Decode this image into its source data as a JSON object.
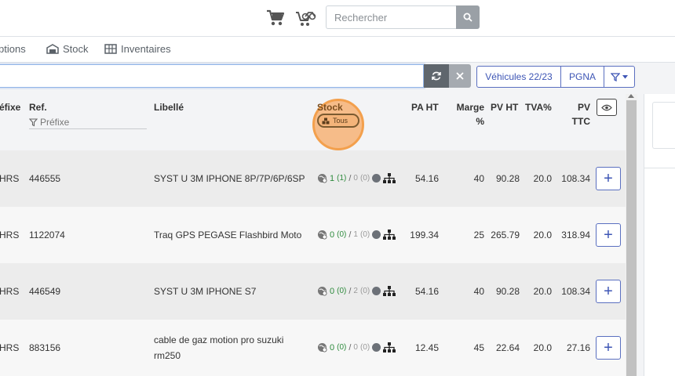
{
  "header": {
    "search_placeholder": "Rechercher",
    "icons": [
      "cart-icon",
      "motorbike-cart-icon",
      "search-icon"
    ]
  },
  "nav": {
    "items": [
      {
        "label": "ptions"
      },
      {
        "label": "Stock",
        "icon": "warehouse-icon"
      },
      {
        "label": "Inventaires",
        "icon": "inventory-icon"
      }
    ]
  },
  "filterbar": {
    "vehicles_label": "Véhicules 22/23",
    "pgna_label": "PGNA",
    "icons": [
      "refresh-icon",
      "close-icon",
      "filter-icon",
      "caret-down-icon"
    ]
  },
  "table": {
    "headers": {
      "prefix": "éfixe",
      "ref": "Ref.",
      "ref_filter_placeholder": "Préfixe",
      "libelle": "Libellé",
      "stock": "Stock",
      "stock_toggle": "Tous",
      "pa_ht": "PA HT",
      "marge_line1": "Marge",
      "marge_line2": "%",
      "pv_ht": "PV HT",
      "tva": "TVA%",
      "pv_ttc_line1": "PV",
      "pv_ttc_line2": "TTC"
    },
    "rows": [
      {
        "prefix": "HRS",
        "ref": "446555",
        "libelle_line1": "SYST U 3M IPHONE 8P/7P/6P/6SP",
        "libelle_line2": "",
        "stock_qty": "1",
        "stock_reserved": "(1)",
        "stock_order": "0",
        "stock_order_paren": "(0)",
        "pa_ht": "54.16",
        "marge": "40",
        "pv_ht": "90.28",
        "tva": "20.0",
        "pv_ttc": "108.34",
        "add_label": "+"
      },
      {
        "prefix": "HRS",
        "ref": "1122074",
        "libelle_line1": "Traq GPS PEGASE Flashbird Moto",
        "libelle_line2": "",
        "stock_qty": "0",
        "stock_reserved": "(0)",
        "stock_order": "1",
        "stock_order_paren": "(0)",
        "pa_ht": "199.34",
        "marge": "25",
        "pv_ht": "265.79",
        "tva": "20.0",
        "pv_ttc": "318.94",
        "add_label": "+"
      },
      {
        "prefix": "HRS",
        "ref": "446549",
        "libelle_line1": "SYST U 3M IPHONE S7",
        "libelle_line2": "",
        "stock_qty": "0",
        "stock_reserved": "(0)",
        "stock_order": "2",
        "stock_order_paren": "(0)",
        "pa_ht": "54.16",
        "marge": "40",
        "pv_ht": "90.28",
        "tva": "20.0",
        "pv_ttc": "108.34",
        "add_label": "+"
      },
      {
        "prefix": "HRS",
        "ref": "883156",
        "libelle_line1": "cable de gaz motion pro suzuki",
        "libelle_line2": "rm250",
        "stock_qty": "0",
        "stock_reserved": "(0)",
        "stock_order": "0",
        "stock_order_paren": "(0)",
        "pa_ht": "12.45",
        "marge": "45",
        "pv_ht": "22.64",
        "tva": "20.0",
        "pv_ttc": "27.16",
        "add_label": "+"
      }
    ]
  },
  "colors": {
    "accent": "#3d55b5",
    "stock_green": "#2e8b3d",
    "highlight": "#f3a04d"
  }
}
